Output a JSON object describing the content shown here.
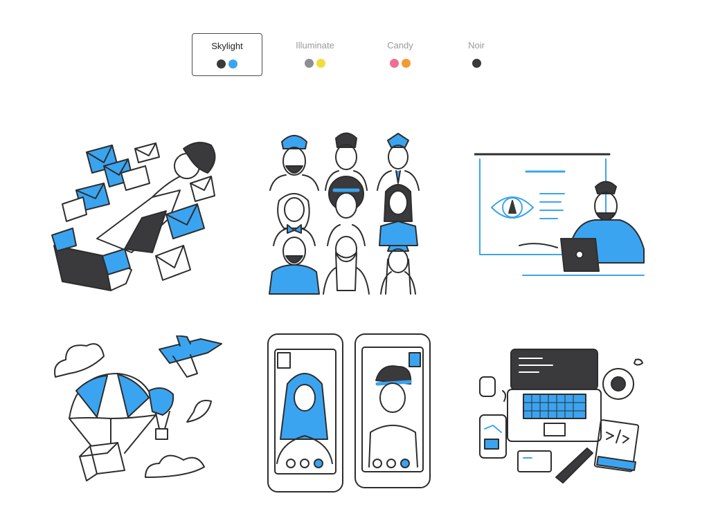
{
  "themes": [
    {
      "label": "Skylight",
      "selected": true,
      "colors": [
        "#3a3a3c",
        "#3ba4f0"
      ]
    },
    {
      "label": "Illuminate",
      "selected": false,
      "colors": [
        "#8e8e93",
        "#f2dc3a"
      ]
    },
    {
      "label": "Candy",
      "selected": false,
      "colors": [
        "#ee6f93",
        "#f39b33"
      ]
    },
    {
      "label": "Noir",
      "selected": false,
      "colors": [
        "#3a3a3c"
      ]
    }
  ],
  "colors": {
    "ink": "#2d2d2d",
    "accent": "#3ba4f0",
    "paper": "#ffffff"
  }
}
